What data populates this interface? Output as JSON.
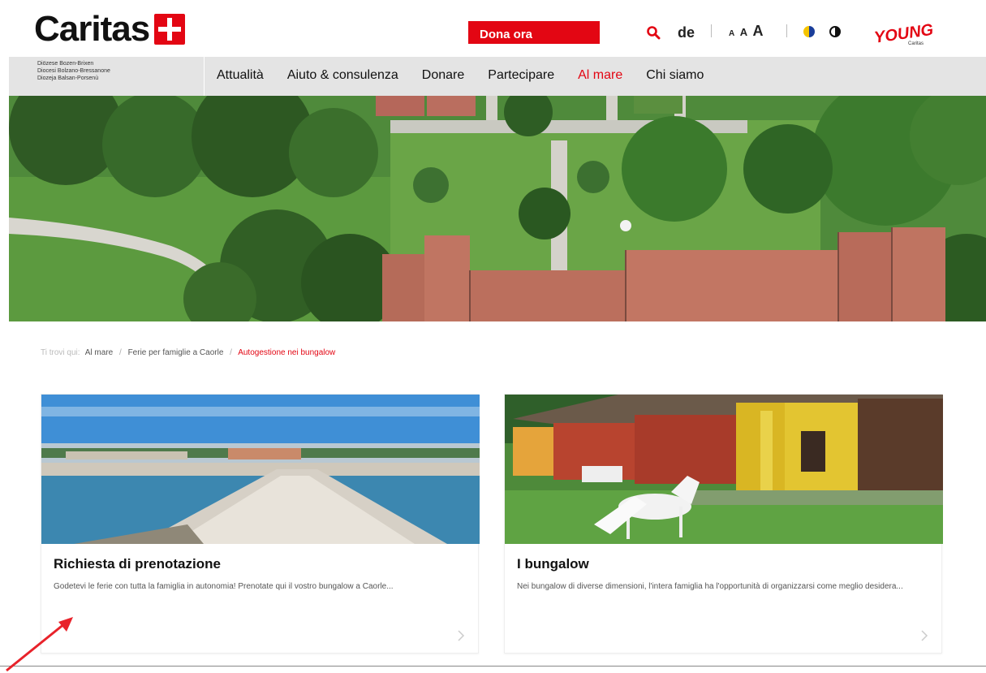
{
  "header": {
    "logo_text": "Caritas",
    "donate_label": "Dona ora",
    "language_label": "de",
    "font_sizes": [
      "A",
      "A",
      "A"
    ],
    "young_label": "YOUNG",
    "young_sub": "Caritas"
  },
  "nav": {
    "diocese_lines": [
      "Diözese Bozen-Brixen",
      "Diocesi Bolzano-Bressanone",
      "Diozeja Balsan-Porsenù"
    ],
    "items": [
      {
        "label": "Attualità",
        "active": false
      },
      {
        "label": "Aiuto & consulenza",
        "active": false
      },
      {
        "label": "Donare",
        "active": false
      },
      {
        "label": "Partecipare",
        "active": false
      },
      {
        "label": "Al mare",
        "active": true
      },
      {
        "label": "Chi siamo",
        "active": false
      }
    ]
  },
  "breadcrumb": {
    "prefix": "Ti trovi qui:",
    "items": [
      "Al mare",
      "Ferie per famiglie a Caorle"
    ],
    "current": "Autogestione nei bungalow"
  },
  "cards": [
    {
      "title": "Richiesta di prenotazione",
      "text": "Godetevi le ferie con tutta la famiglia in autonomia! Prenotate qui il vostro bungalow a Caorle..."
    },
    {
      "title": "I bungalow",
      "text": "Nei bungalow di diverse dimensioni, l'intera famiglia ha l'opportunità di organizzarsi come meglio desidera..."
    }
  ],
  "colors": {
    "brand_red": "#e30613",
    "nav_bg": "#e4e4e4"
  }
}
